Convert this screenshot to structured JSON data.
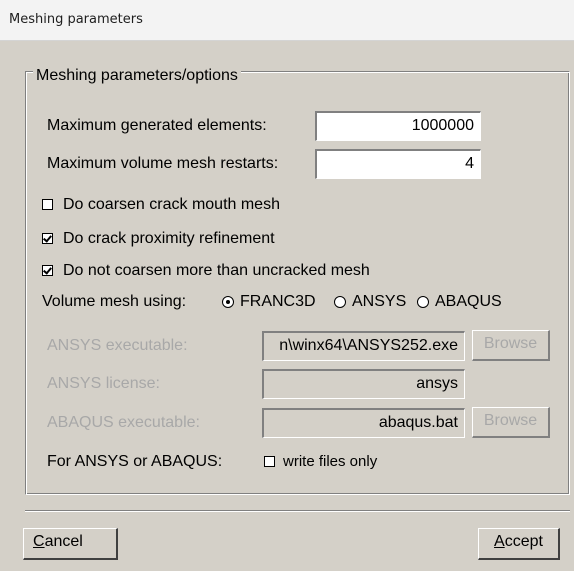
{
  "window": {
    "title": "Meshing parameters"
  },
  "group": {
    "title": "Meshing parameters/options"
  },
  "max_elements": {
    "label": "Maximum generated elements:",
    "value": "1000000"
  },
  "max_restarts": {
    "label": "Maximum volume mesh restarts:",
    "value": "4"
  },
  "options": {
    "coarsen_mouth": {
      "label": "Do coarsen crack mouth mesh",
      "checked": false
    },
    "proximity": {
      "label": "Do crack proximity refinement",
      "checked": true
    },
    "no_coarsen": {
      "label": "Do not coarsen more than uncracked mesh",
      "checked": true
    }
  },
  "volume_mesh": {
    "label": "Volume mesh using:",
    "opt1": "FRANC3D",
    "opt2": "ANSYS",
    "opt3": "ABAQUS",
    "selected": "FRANC3D"
  },
  "ansys_exe": {
    "label": "ANSYS executable:",
    "value": "n\\winx64\\ANSYS252.exe",
    "browse": "Browse"
  },
  "ansys_license": {
    "label": "ANSYS license:",
    "value": "ansys"
  },
  "abaqus_exe": {
    "label": "ABAQUS executable:",
    "value": "abaqus.bat",
    "browse": "Browse"
  },
  "files_only": {
    "label": "For ANSYS or ABAQUS:",
    "checkbox_label": "write files only",
    "checked": false
  },
  "buttons": {
    "cancel_mnemonic": "C",
    "cancel_rest": "ancel",
    "accept_mnemonic": "A",
    "accept_rest": "ccept"
  },
  "colors": {
    "dialog_bg": "#d4d0c8",
    "disabled_text": "#a8a8a8"
  }
}
